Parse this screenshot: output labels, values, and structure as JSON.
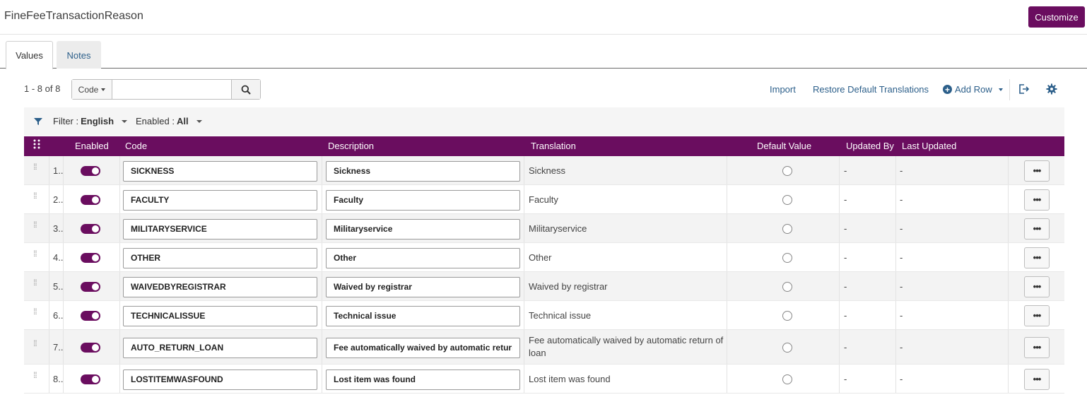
{
  "title": "FineFeeTransactionReason",
  "customize_label": "Customize",
  "tabs": [
    "Values",
    "Notes"
  ],
  "toolbar": {
    "count": "1 - 8 of 8",
    "search_field": "Code",
    "search_value": "",
    "import_label": "Import",
    "restore_label": "Restore Default Translations",
    "add_row_label": "Add Row"
  },
  "filters": {
    "lang_label": "Filter :",
    "lang_value": "English",
    "enabled_label": "Enabled :",
    "enabled_value": "All"
  },
  "columns": {
    "enabled": "Enabled",
    "code": "Code",
    "description": "Description",
    "translation": "Translation",
    "default_value": "Default Value",
    "updated_by": "Updated By",
    "last_updated": "Last Updated"
  },
  "rows": [
    {
      "num": "1..",
      "code": "SICKNESS",
      "description": "Sickness",
      "translation": "Sickness",
      "updated_by": "-",
      "last_updated": "-"
    },
    {
      "num": "2..",
      "code": "FACULTY",
      "description": "Faculty",
      "translation": "Faculty",
      "updated_by": "-",
      "last_updated": "-"
    },
    {
      "num": "3..",
      "code": "MILITARYSERVICE",
      "description": "Militaryservice",
      "translation": "Militaryservice",
      "updated_by": "-",
      "last_updated": "-"
    },
    {
      "num": "4..",
      "code": "OTHER",
      "description": "Other",
      "translation": "Other",
      "updated_by": "-",
      "last_updated": "-"
    },
    {
      "num": "5..",
      "code": "WAIVEDBYREGISTRAR",
      "description": "Waived by registrar",
      "translation": "Waived by registrar",
      "updated_by": "-",
      "last_updated": "-"
    },
    {
      "num": "6..",
      "code": "TECHNICALISSUE",
      "description": "Technical issue",
      "translation": "Technical issue",
      "updated_by": "-",
      "last_updated": "-"
    },
    {
      "num": "7..",
      "code": "AUTO_RETURN_LOAN",
      "description": "Fee automatically waived by automatic return of loan",
      "translation": "Fee automatically waived by automatic return of loan",
      "updated_by": "-",
      "last_updated": "-"
    },
    {
      "num": "8..",
      "code": "LOSTITEMWASFOUND",
      "description": "Lost item was found",
      "translation": "Lost item was found",
      "updated_by": "-",
      "last_updated": "-"
    }
  ],
  "more_label": "•••",
  "accent_color": "#6a0d5f",
  "link_color": "#2c5f8a"
}
